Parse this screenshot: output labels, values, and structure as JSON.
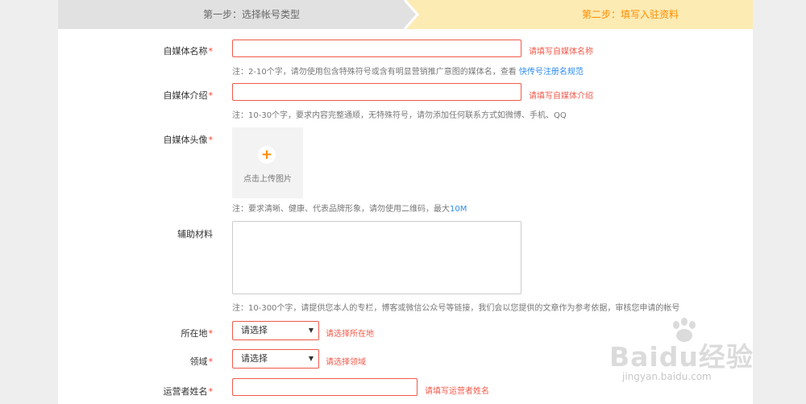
{
  "steps": {
    "step1": "第一步：选择帐号类型",
    "step2": "第二步：填写入驻资料"
  },
  "form": {
    "media_name": {
      "label": "自媒体名称",
      "required": "*",
      "error": "请填写自媒体名称",
      "note_prefix": "注：2-10个字，请勿使用包含特殊符号或含有明显营销推广意图的媒体名，查看",
      "note_link": "快传号注册名规范"
    },
    "media_intro": {
      "label": "自媒体介绍",
      "required": "*",
      "error": "请填写自媒体介绍",
      "note": "注：10-30个字，要求内容完整通顺，无特殊符号，请勿添加任何联系方式如微博、手机、QQ"
    },
    "avatar": {
      "label": "自媒体头像",
      "required": "*",
      "upload_plus": "+",
      "upload_text": "点击上传图片",
      "note_prefix": "注：要求清晰、健康、代表品牌形象，请勿使用二维码，最大",
      "note_size": "10M"
    },
    "aux_material": {
      "label": "辅助材料",
      "note": "注：10-300个字，请提供您本人的专栏，博客或微信公众号等链接，我们会以您提供的文章作为参考依据，审核您申请的帐号"
    },
    "location": {
      "label": "所在地",
      "required": "*",
      "selected": "请选择",
      "caret": "▼",
      "error": "请选择所在地"
    },
    "field": {
      "label": "领域",
      "required": "*",
      "selected": "请选择",
      "caret": "▼",
      "error": "请选择领域"
    },
    "operator_name": {
      "label": "运营者姓名",
      "required": "*",
      "error": "请填写运营者姓名"
    }
  },
  "watermark": {
    "brand": "Baidu经验",
    "url": "jingyan.baidu.com"
  },
  "colors": {
    "error": "#f05a4a",
    "accent": "#ff8c00",
    "link": "#2d8cf0",
    "step_inactive": "#e1e1e1",
    "step_active": "#fdebb4"
  }
}
